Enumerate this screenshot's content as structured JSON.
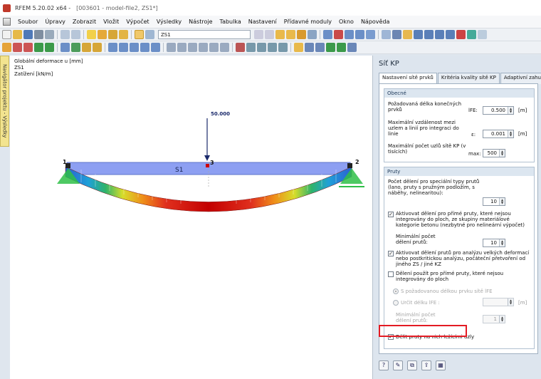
{
  "titlebar": {
    "app": "RFEM 5.20.02 x64 -",
    "document": "[003601 - model-file2, ZS1*]"
  },
  "menu": [
    "Soubor",
    "Úpravy",
    "Zobrazit",
    "Vložit",
    "Výpočet",
    "Výsledky",
    "Nástroje",
    "Tabulka",
    "Nastavení",
    "Přídavné moduly",
    "Okno",
    "Nápověda"
  ],
  "toolbar": {
    "loadcase": "ZS1"
  },
  "navigator": {
    "label": "Navigátor projektu - Výsledky"
  },
  "viewport": {
    "info": [
      "Globální deformace u [mm]",
      "ZS1",
      "Zatížení [kN/m]"
    ],
    "member_label": "S1",
    "load_value": "50.000",
    "nodes": [
      "1",
      "2",
      "3"
    ],
    "colors": {
      "member": "#8d9ff2",
      "deform_outer": "#2c5fd2",
      "deform_center": "#c80000",
      "support": "#2fbf48"
    }
  },
  "panel": {
    "title": "Síť KP",
    "tabs": [
      "Nastavení sítě prvků",
      "Kritéria kvality sítě KP",
      "Adaptivní zahuštění sít"
    ],
    "general": {
      "title": "Obecné",
      "rows": [
        {
          "label": "Požadovaná délka konečných prvků",
          "symbol": "lFE:",
          "value": "0.500",
          "unit": "[m]"
        },
        {
          "label": "Maximální vzdálenost mezi uzlem a linií pro integraci do linie",
          "symbol": "ε:",
          "value": "0.001",
          "unit": "[m]"
        },
        {
          "label": "Maximální počet uzlů sítě KP (v tisících)",
          "symbol": "max:",
          "value": "500",
          "unit": ""
        }
      ]
    },
    "members": {
      "title": "Pruty",
      "division_label": "Počet dělení pro speciální typy prutů (lano, pruty s pružným podložím, s náběhy, nelinearitou):",
      "division_value": "10",
      "cb1_label": "Aktivovat dělení pro přímé pruty, které nejsou integrovány do ploch, ze skupiny materiálové kategorie betonu (nezbytné pro nelineární výpočet)",
      "cb1_checked": "✓",
      "min1_label": "Minimální počet dělení prutů:",
      "min1_value": "10",
      "cb2_label": "Aktivovat dělení prutů pro analýzu velkých deformací nebo postkritickou analýzu, počáteční přetvoření od jiného ZS / jiné KZ",
      "cb2_checked": "✓",
      "cb3_label": "Dělení použít pro přímé pruty, které nejsou integrovány do ploch",
      "cb3_checked": "",
      "radio1_label": "S požadovanou délkou prvku sítě lFE",
      "radio2_label": "Určit délku lFE :",
      "radio2_unit": "[m]",
      "min2_label": "Minimální počet dělení prutů:",
      "min2_value": "1",
      "cb4_label": "Dělit pruty na nich ležícími uzly",
      "cb4_checked": "✓"
    },
    "bottom_buttons": [
      "help-icon",
      "edit-icon",
      "copy-icon",
      "export-icon",
      "table-icon"
    ]
  }
}
